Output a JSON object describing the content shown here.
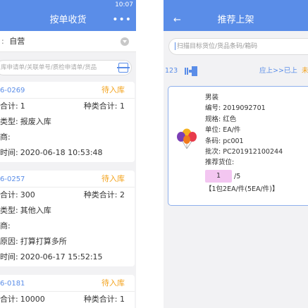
{
  "left": {
    "status_time": "10:07",
    "nav_title": "按单收货",
    "nav_more": "•••",
    "filter": {
      "label": ":",
      "value": "自营"
    },
    "search_placeholder": "库申请单/关联单号/质检申请单/货品",
    "orders": [
      {
        "order_no": "6-0269",
        "status": "待入库",
        "lines": [
          {
            "label": "合计:",
            "value": "1",
            "right_label": "种类合计:",
            "right_value": "1"
          },
          {
            "label": "类型:",
            "value": "报废入库"
          },
          {
            "label": "商:",
            "value": ""
          },
          {
            "label": "时间:",
            "value": "2020-06-18 10:53:48"
          }
        ]
      },
      {
        "order_no": "6-0257",
        "status": "待入库",
        "lines": [
          {
            "label": "合计:",
            "value": "300",
            "right_label": "种类合计:",
            "right_value": "2"
          },
          {
            "label": "类型:",
            "value": "其他入库"
          },
          {
            "label": "商:",
            "value": ""
          },
          {
            "label": "原因:",
            "value": "打算打算多所"
          },
          {
            "label": "时间:",
            "value": "2020-06-17 15:52:15"
          }
        ]
      },
      {
        "order_no": "6-0181",
        "status": "待入库",
        "lines": [
          {
            "label": "合计:",
            "value": "10000",
            "right_label": "种类合计:",
            "right_value": "1"
          }
        ]
      }
    ]
  },
  "right": {
    "nav_back": "←",
    "nav_title": "推荐上架",
    "search_placeholder": "扫描目标货位/货品条码/箱码",
    "toolbar": {
      "count": "123",
      "flow_label": "应上>>已上",
      "extra": "未"
    },
    "product": {
      "name": "男装",
      "code": "编号: 2019092701",
      "spec": "规格: 红色",
      "unit": "单位: EA/件",
      "barcode": "条码: pc001",
      "batch": "批次: PC201912100244",
      "recommend_label": "推荐货位:",
      "qty_current": "1",
      "qty_total": "/5",
      "pack_info": "【1包2EA/件(5EA/件)】"
    },
    "colors": {
      "primary": "#5a8de8",
      "pending": "#f3a21b",
      "qty_bg": "#f3c6f1"
    }
  }
}
